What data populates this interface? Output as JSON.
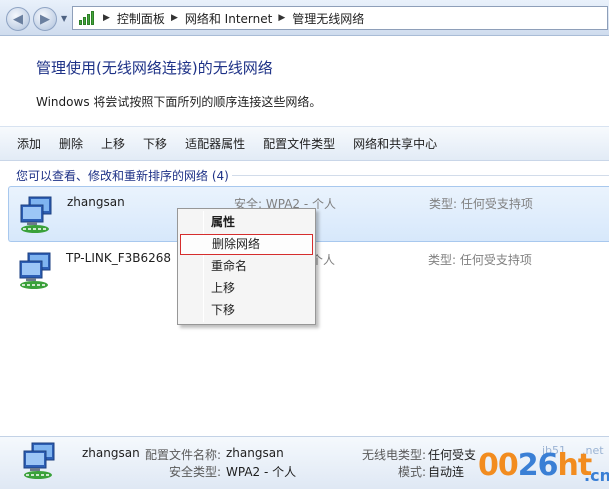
{
  "addressbar": {
    "breadcrumbs": [
      "控制面板",
      "网络和 Internet",
      "管理无线网络"
    ]
  },
  "header": {
    "title": "管理使用(无线网络连接)的无线网络",
    "description": "Windows 将尝试按照下面所列的顺序连接这些网络。"
  },
  "toolbar": {
    "add": "添加",
    "delete": "删除",
    "move_up": "上移",
    "move_down": "下移",
    "adapter_properties": "适配器属性",
    "profile_types": "配置文件类型",
    "network_sharing_center": "网络和共享中心"
  },
  "list": {
    "header": "您可以查看、修改和重新排序的网络 (4)",
    "networks": [
      {
        "name": "zhangsan",
        "security": "安全: WPA2 - 个人",
        "type": "类型: 任何受支持项"
      },
      {
        "name": "TP-LINK_F3B6268",
        "security": "安全: WPA2 - 个人",
        "type": "类型: 任何受支持项"
      }
    ]
  },
  "context_menu": {
    "items": [
      "属性",
      "删除网络",
      "重命名",
      "上移",
      "下移"
    ]
  },
  "details": {
    "name": "zhangsan",
    "profile_name_label": "配置文件名称:",
    "profile_name_value": "zhangsan",
    "security_type_label": "安全类型:",
    "security_type_value": "WPA2 - 个人",
    "radio_type_label": "无线电类型:",
    "radio_type_value": "任何受支",
    "mode_label": "模式:",
    "mode_value": "自动连"
  },
  "watermark": {
    "main_a": "00",
    "main_b": "26",
    "main_c": "ht",
    "domain_small": "jb51",
    "net": ".net",
    "cn": ".cn"
  },
  "colors": {
    "link_blue": "#1e3287",
    "selection": "#d7e8fb",
    "menu_highlight_border": "#d52d2d"
  }
}
